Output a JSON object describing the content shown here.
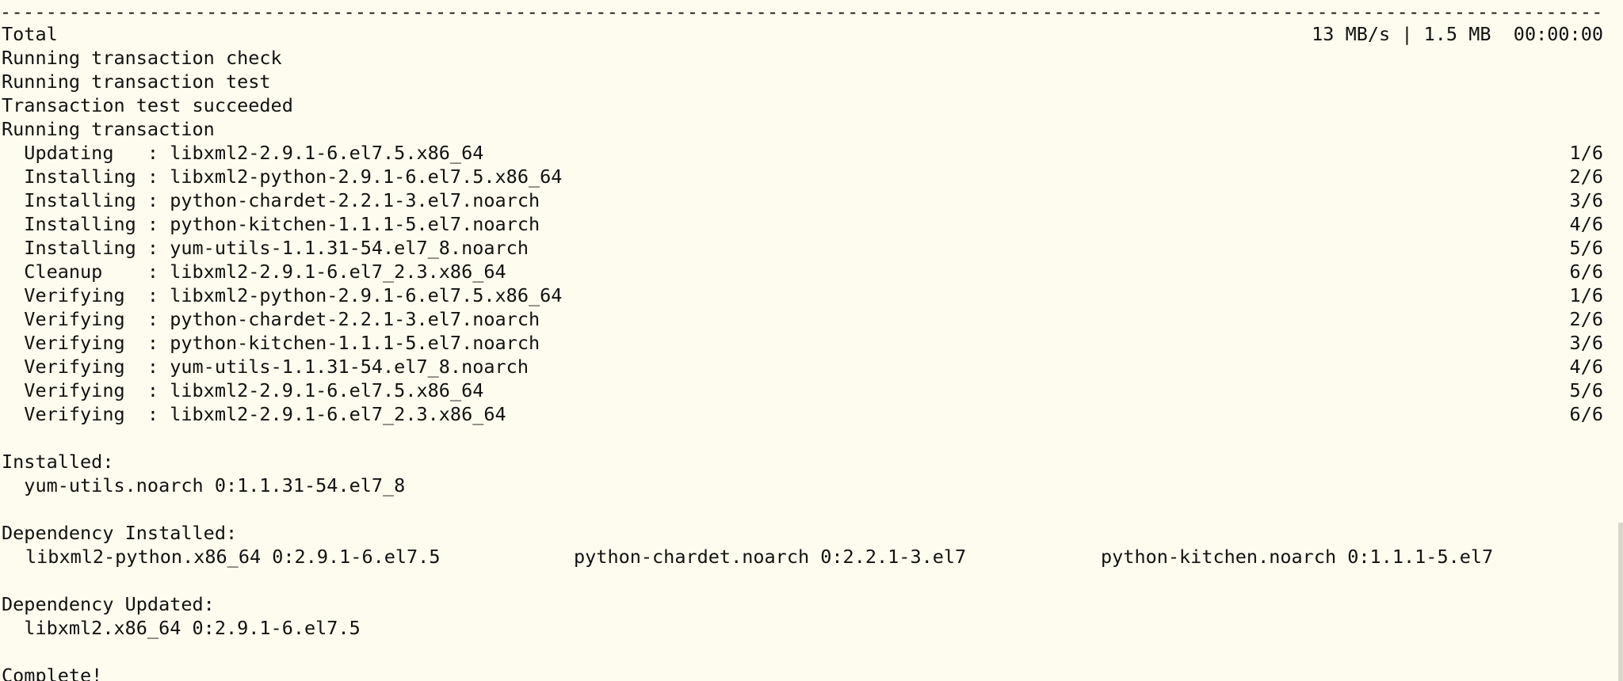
{
  "terminal": {
    "rule": "--------------------------------------------------------------------------------------------------------------------------------------------------------------------------------------------------------------",
    "total": {
      "label": "Total",
      "stats": "13 MB/s | 1.5 MB  00:00:00"
    },
    "transaction_lines": [
      "Running transaction check",
      "Running transaction test",
      "Transaction test succeeded",
      "Running transaction"
    ],
    "steps": [
      {
        "text": "  Updating   : libxml2-2.9.1-6.el7.5.x86_64",
        "progress": "1/6"
      },
      {
        "text": "  Installing : libxml2-python-2.9.1-6.el7.5.x86_64",
        "progress": "2/6"
      },
      {
        "text": "  Installing : python-chardet-2.2.1-3.el7.noarch",
        "progress": "3/6"
      },
      {
        "text": "  Installing : python-kitchen-1.1.1-5.el7.noarch",
        "progress": "4/6"
      },
      {
        "text": "  Installing : yum-utils-1.1.31-54.el7_8.noarch",
        "progress": "5/6"
      },
      {
        "text": "  Cleanup    : libxml2-2.9.1-6.el7_2.3.x86_64",
        "progress": "6/6"
      },
      {
        "text": "  Verifying  : libxml2-python-2.9.1-6.el7.5.x86_64",
        "progress": "1/6"
      },
      {
        "text": "  Verifying  : python-chardet-2.2.1-3.el7.noarch",
        "progress": "2/6"
      },
      {
        "text": "  Verifying  : python-kitchen-1.1.1-5.el7.noarch",
        "progress": "3/6"
      },
      {
        "text": "  Verifying  : yum-utils-1.1.31-54.el7_8.noarch",
        "progress": "4/6"
      },
      {
        "text": "  Verifying  : libxml2-2.9.1-6.el7.5.x86_64",
        "progress": "5/6"
      },
      {
        "text": "  Verifying  : libxml2-2.9.1-6.el7_2.3.x86_64",
        "progress": "6/6"
      }
    ],
    "installed": {
      "heading": "Installed:",
      "package": "  yum-utils.noarch 0:1.1.31-54.el7_8"
    },
    "dependency_installed": {
      "heading": "Dependency Installed:",
      "packages": [
        "libxml2-python.x86_64 0:2.9.1-6.el7.5",
        "python-chardet.noarch 0:2.2.1-3.el7",
        "python-kitchen.noarch 0:1.1.1-5.el7"
      ]
    },
    "dependency_updated": {
      "heading": "Dependency Updated:",
      "package": "  libxml2.x86_64 0:2.9.1-6.el7.5"
    },
    "complete": "Complete!"
  }
}
